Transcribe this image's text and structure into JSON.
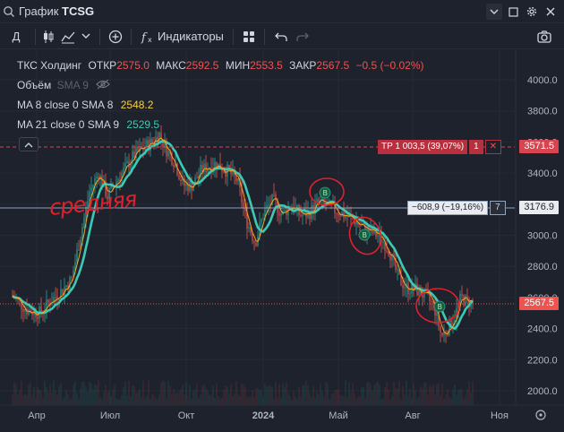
{
  "window": {
    "title_prefix": "График",
    "title_symbol": "TCSG"
  },
  "toolbar": {
    "interval": "Д",
    "indicators_label": "Индикаторы"
  },
  "legend": {
    "name": "ТКС Холдинг",
    "open_label": "ОТКР",
    "open_value": "2575.0",
    "high_label": "МАКС",
    "high_value": "2592.5",
    "low_label": "МИН",
    "low_value": "2553.5",
    "close_label": "ЗАКР",
    "close_value": "2567.5",
    "change": "−0.5 (−0.02%)",
    "volume_label": "Объём",
    "volume_params": "SMA 9",
    "ma8_label": "MA 8 close 0 SMA 8",
    "ma8_value": "2548.2",
    "ma21_label": "MA 21 close 0 SMA 9",
    "ma21_value": "2529.5"
  },
  "orders": {
    "tp_label": "TP 1 003,5 (39,07%)",
    "tp_qty": "1",
    "tp_close": "✕",
    "position_label": "−608,9 (−19,16%)",
    "position_qty": "7"
  },
  "price_axis": {
    "ticks": [
      "4000.0",
      "3800.0",
      "3600.0",
      "3400.0",
      "3200.0",
      "3000.0",
      "2800.0",
      "2600.0",
      "2400.0",
      "2200.0",
      "2000.0"
    ],
    "tp_price": "3571.5",
    "position_price": "3176.9",
    "last_price": "2567.5"
  },
  "time_axis": {
    "ticks": [
      "Апр",
      "Июл",
      "Окт",
      "2024",
      "Май",
      "Авг",
      "Ноя"
    ]
  },
  "annotation_text": "средняя",
  "colors": {
    "background": "#1e222d",
    "up": "#26a69a",
    "down": "#ef5350",
    "ma8": "#f5a623",
    "ma21": "#3ec9b4",
    "tp": "#d94451",
    "position": "#8fa3bb"
  }
}
